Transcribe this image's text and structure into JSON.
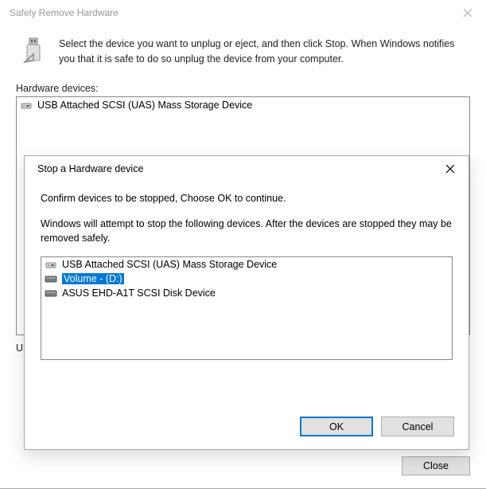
{
  "main": {
    "title": "Safely Remove Hardware",
    "description": "Select the device you want to unplug or eject, and then click Stop. When Windows notifies you that it is safe to do so unplug the device from your computer.",
    "hardwareLabel": "Hardware devices:",
    "devices": [
      {
        "label": "USB Attached SCSI (UAS) Mass Storage Device",
        "icon": "usb-controller"
      }
    ],
    "partialBelow": "US",
    "closeButton": "Close"
  },
  "modal": {
    "title": "Stop a Hardware device",
    "confirmText": "Confirm devices to be stopped, Choose OK to continue.",
    "attemptText": "Windows will attempt to stop the following devices. After the devices are stopped they may be removed safely.",
    "devices": [
      {
        "label": "USB Attached SCSI (UAS) Mass Storage Device",
        "icon": "usb-controller",
        "selected": false
      },
      {
        "label": "Volume - (D:)",
        "icon": "drive",
        "selected": true
      },
      {
        "label": "ASUS EHD-A1T SCSI Disk Device",
        "icon": "drive",
        "selected": false
      }
    ],
    "okButton": "OK",
    "cancelButton": "Cancel"
  }
}
